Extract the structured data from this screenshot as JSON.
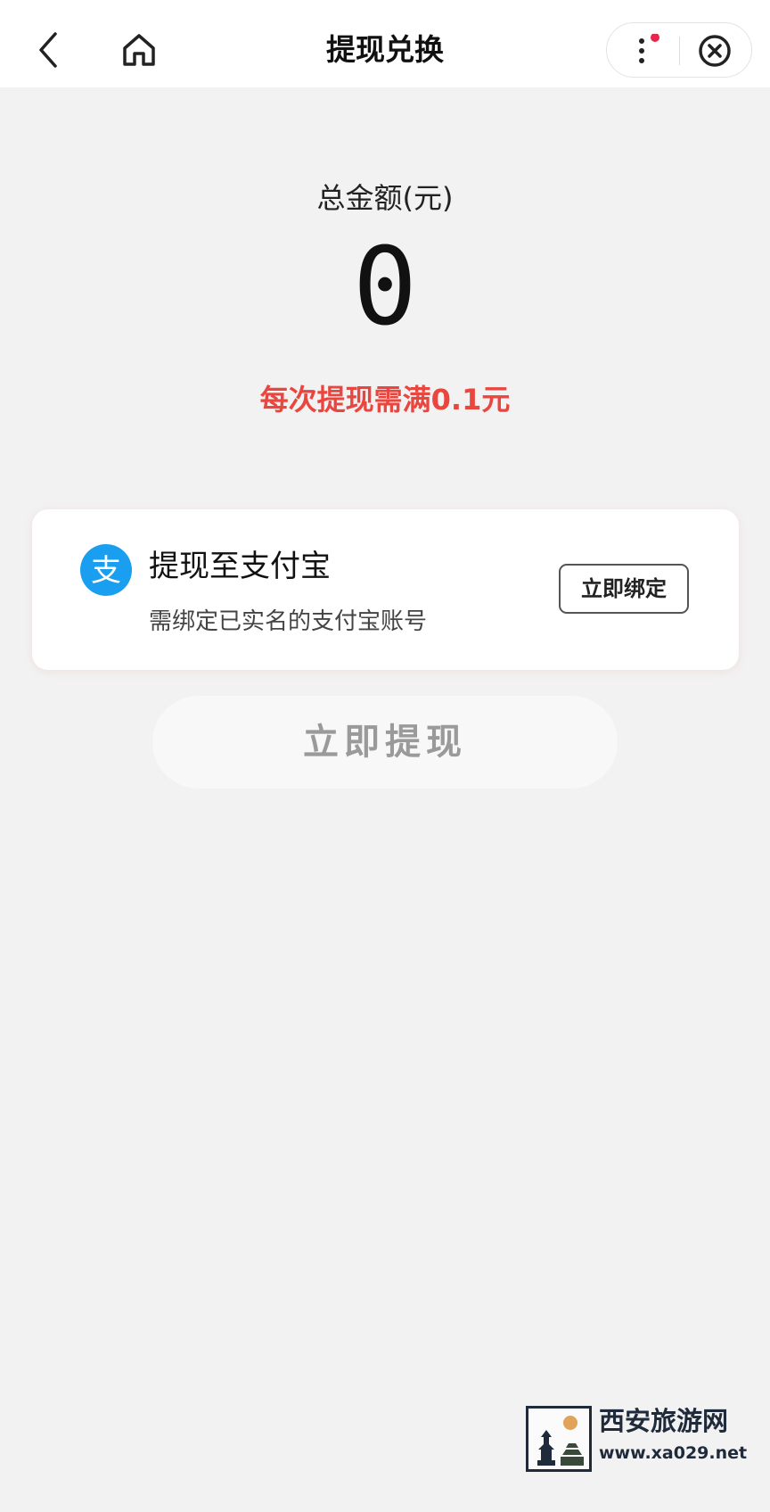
{
  "header": {
    "title": "提现兑换"
  },
  "balance": {
    "label": "总金额(元)",
    "value": "0",
    "min_note": "每次提现需满0.1元"
  },
  "payout_card": {
    "icon_glyph": "支",
    "title": "提现至支付宝",
    "subtitle": "需绑定已实名的支付宝账号",
    "bind_label": "立即绑定"
  },
  "withdraw_label": "立即提现",
  "watermark": {
    "title": "西安旅游网",
    "url": "www.xa029.net"
  },
  "colors": {
    "accent_red": "#e8463f",
    "alipay_blue": "#1a9ff0",
    "background": "#f2f2f2",
    "notification_dot": "#e8254b"
  }
}
